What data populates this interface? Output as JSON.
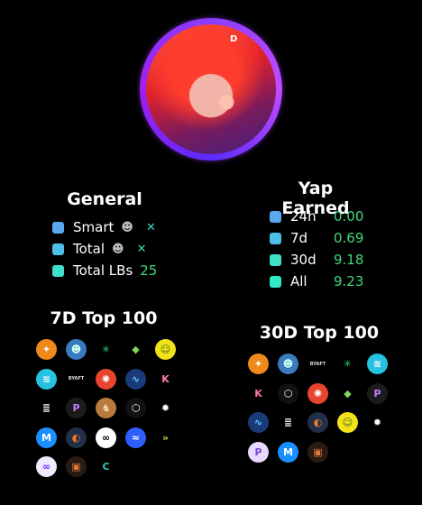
{
  "avatar": {
    "deco": "D"
  },
  "general": {
    "title": "General",
    "rows": [
      {
        "label": "Smart",
        "color": "#5aa8f0",
        "value": ""
      },
      {
        "label": "Total",
        "color": "#4ec0e8",
        "value": ""
      },
      {
        "label": "Total LBs",
        "color": "#3fe0c8",
        "value": "25"
      }
    ]
  },
  "yap": {
    "title": "Yap Earned",
    "rows": [
      {
        "label": "24h",
        "color": "#5aa8f0",
        "value": "0.00"
      },
      {
        "label": "7d",
        "color": "#4ec0e8",
        "value": "0.69"
      },
      {
        "label": "30d",
        "color": "#3fe0c8",
        "value": "9.18"
      },
      {
        "label": "All",
        "color": "#33e6c8",
        "value": "9.23"
      }
    ]
  },
  "top7": {
    "title": "7D Top 100",
    "tokens": [
      {
        "name": "gold-feather-token",
        "glyph": "✦",
        "bg": "#f0891c",
        "fg": "#fff"
      },
      {
        "name": "sloth-token",
        "glyph": "☻",
        "bg": "#3a7ac0",
        "fg": "#cfe"
      },
      {
        "name": "green-asterisk-token",
        "glyph": "✳",
        "bg": "#000",
        "fg": "#2ecc71"
      },
      {
        "name": "green-diamond-token",
        "glyph": "◆",
        "bg": "#000",
        "fg": "#7ed957"
      },
      {
        "name": "pepe-token",
        "glyph": "☺",
        "bg": "#f2e21a",
        "fg": "#3a6b1e"
      },
      {
        "name": "wave-token",
        "glyph": "≋",
        "bg": "#27c2e0",
        "fg": "#fff"
      },
      {
        "name": "byaft-token",
        "glyph": "BYAFT",
        "bg": "#000",
        "fg": "#ddd"
      },
      {
        "name": "red-blob-token",
        "glyph": "✺",
        "bg": "#e8452e",
        "fg": "#fff"
      },
      {
        "name": "blue-swoosh-token",
        "glyph": "∿",
        "bg": "#1a3a7a",
        "fg": "#5cf"
      },
      {
        "name": "k-token",
        "glyph": "K",
        "bg": "#000",
        "fg": "#ff7aa0"
      },
      {
        "name": "zigzag-token",
        "glyph": "≣",
        "bg": "#000",
        "fg": "#fff"
      },
      {
        "name": "p-purple-token",
        "glyph": "P",
        "bg": "#1b1b1b",
        "fg": "#c47cff"
      },
      {
        "name": "monkey-token",
        "glyph": "♞",
        "bg": "#b97a3f",
        "fg": "#f5d5a8"
      },
      {
        "name": "hex-token",
        "glyph": "⬡",
        "bg": "#111",
        "fg": "#fff"
      },
      {
        "name": "burst-token",
        "glyph": "✹",
        "bg": "#000",
        "fg": "#fff"
      },
      {
        "name": "blue-m-token",
        "glyph": "M",
        "bg": "#1a8fff",
        "fg": "#fff"
      },
      {
        "name": "orange-circle-token",
        "glyph": "◐",
        "bg": "#203048",
        "fg": "#f07a2a"
      },
      {
        "name": "link-token",
        "glyph": "∞",
        "bg": "#fff",
        "fg": "#000"
      },
      {
        "name": "blue-wave-token",
        "glyph": "≈",
        "bg": "#2d5fff",
        "fg": "#fff"
      },
      {
        "name": "chevron-token",
        "glyph": "»",
        "bg": "#000",
        "fg": "#a8e04a"
      },
      {
        "name": "purple-link-token",
        "glyph": "∞",
        "bg": "#f0eaff",
        "fg": "#6a2cff"
      },
      {
        "name": "orange-square-token",
        "glyph": "▣",
        "bg": "#2a1a14",
        "fg": "#e07a3a"
      },
      {
        "name": "c-token",
        "glyph": "C",
        "bg": "#000",
        "fg": "#2ad0c0"
      }
    ]
  },
  "top30": {
    "title": "30D Top 100",
    "tokens": [
      {
        "name": "gold-feather-token",
        "glyph": "✦",
        "bg": "#f0891c",
        "fg": "#fff"
      },
      {
        "name": "sloth-token",
        "glyph": "☻",
        "bg": "#3a7ac0",
        "fg": "#cfe"
      },
      {
        "name": "byaft-token",
        "glyph": "BYAFT",
        "bg": "#000",
        "fg": "#ddd"
      },
      {
        "name": "green-asterisk-token",
        "glyph": "✳",
        "bg": "#000",
        "fg": "#2ecc71"
      },
      {
        "name": "wave-token",
        "glyph": "≋",
        "bg": "#27c2e0",
        "fg": "#fff"
      },
      {
        "name": "k-token",
        "glyph": "K",
        "bg": "#000",
        "fg": "#ff7aa0"
      },
      {
        "name": "hex-token",
        "glyph": "⬡",
        "bg": "#111",
        "fg": "#fff"
      },
      {
        "name": "red-blob-token",
        "glyph": "✺",
        "bg": "#e8452e",
        "fg": "#fff"
      },
      {
        "name": "green-diamond-token",
        "glyph": "◆",
        "bg": "#000",
        "fg": "#7ed957"
      },
      {
        "name": "p-purple-token",
        "glyph": "P",
        "bg": "#1b1b1b",
        "fg": "#c47cff"
      },
      {
        "name": "blue-swoosh-token",
        "glyph": "∿",
        "bg": "#1a3a7a",
        "fg": "#5cf"
      },
      {
        "name": "zigzag-token",
        "glyph": "≣",
        "bg": "#000",
        "fg": "#fff"
      },
      {
        "name": "orange-circle-token",
        "glyph": "◐",
        "bg": "#203048",
        "fg": "#f07a2a"
      },
      {
        "name": "pepe-token",
        "glyph": "☺",
        "bg": "#f2e21a",
        "fg": "#3a6b1e"
      },
      {
        "name": "burst-token",
        "glyph": "✹",
        "bg": "#000",
        "fg": "#fff"
      },
      {
        "name": "lavender-p-token",
        "glyph": "P",
        "bg": "#e8d8ff",
        "fg": "#7a4ad0"
      },
      {
        "name": "blue-m-token",
        "glyph": "M",
        "bg": "#1a8fff",
        "fg": "#fff"
      },
      {
        "name": "orange-square-token",
        "glyph": "▣",
        "bg": "#2a1a14",
        "fg": "#e07a3a"
      }
    ]
  }
}
